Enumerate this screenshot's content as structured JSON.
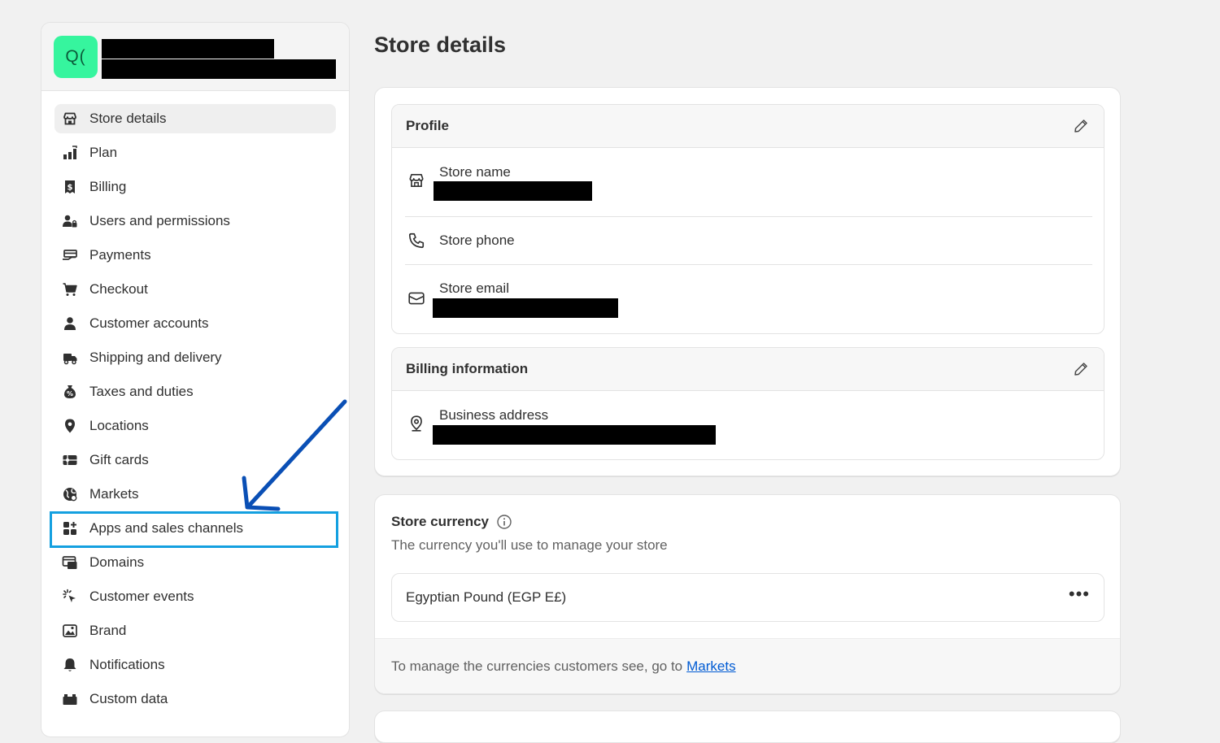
{
  "store": {
    "avatar_initials": "Q("
  },
  "sidebar": {
    "items": [
      {
        "label": "Store details",
        "icon": "store-icon"
      },
      {
        "label": "Plan",
        "icon": "plan-icon"
      },
      {
        "label": "Billing",
        "icon": "billing-icon"
      },
      {
        "label": "Users and permissions",
        "icon": "users-icon"
      },
      {
        "label": "Payments",
        "icon": "payments-icon"
      },
      {
        "label": "Checkout",
        "icon": "cart-icon"
      },
      {
        "label": "Customer accounts",
        "icon": "person-icon"
      },
      {
        "label": "Shipping and delivery",
        "icon": "truck-icon"
      },
      {
        "label": "Taxes and duties",
        "icon": "tax-icon"
      },
      {
        "label": "Locations",
        "icon": "location-pin-icon"
      },
      {
        "label": "Gift cards",
        "icon": "gift-card-icon"
      },
      {
        "label": "Markets",
        "icon": "globe-icon"
      },
      {
        "label": "Apps and sales channels",
        "icon": "apps-icon"
      },
      {
        "label": "Domains",
        "icon": "domains-icon"
      },
      {
        "label": "Customer events",
        "icon": "cursor-click-icon"
      },
      {
        "label": "Brand",
        "icon": "brand-icon"
      },
      {
        "label": "Notifications",
        "icon": "bell-icon"
      },
      {
        "label": "Custom data",
        "icon": "custom-data-icon"
      }
    ],
    "active_index": 0,
    "highlighted_index": 12
  },
  "page": {
    "title": "Store details"
  },
  "profile": {
    "heading": "Profile",
    "store_name_label": "Store name",
    "store_phone_label": "Store phone",
    "store_email_label": "Store email"
  },
  "billing_info": {
    "heading": "Billing information",
    "business_address_label": "Business address"
  },
  "currency": {
    "title": "Store currency",
    "subtitle": "The currency you'll use to manage your store",
    "value": "Egyptian Pound (EGP E£)",
    "more_label": "•••",
    "footer_text": "To manage the currencies customers see, go to",
    "footer_link": "Markets"
  },
  "colors": {
    "avatar_bg": "#36f59e",
    "highlight": "#14a0e0",
    "annotation_arrow": "#0a4fb5",
    "link": "#005bd3"
  }
}
